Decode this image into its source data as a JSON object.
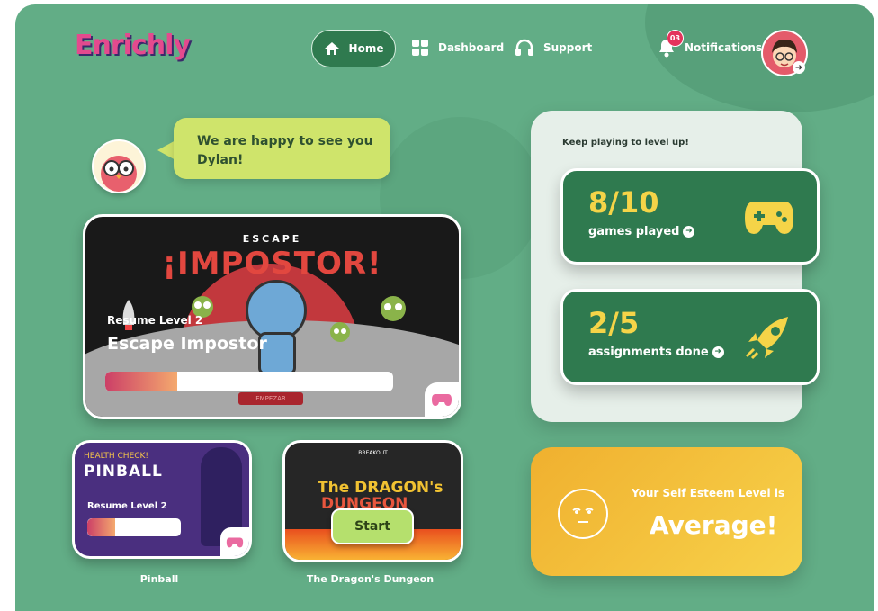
{
  "brand": {
    "logo": "Enrichly"
  },
  "nav": {
    "home": "Home",
    "dashboard": "Dashboard",
    "support": "Support",
    "notifications": "Notifications",
    "notification_count": "03"
  },
  "greeting": {
    "message": "We are happy to see you Dylan!"
  },
  "featured_game": {
    "art_title_small": "ESCAPE",
    "art_title_big": "¡IMPOSTOR!",
    "art_button": "EMPEZAR",
    "resume_label": "Resume Level 2",
    "name": "Escape Impostor",
    "progress": 0.25
  },
  "games": [
    {
      "caption": "Pinball",
      "art_label": "HEALTH CHECK!",
      "art_title": "PINBALL",
      "resume_label": "Resume Level 2",
      "progress": 0.3
    },
    {
      "caption": "The Dragon's Dungeon",
      "art_label": "BREAKOUT",
      "art_title_1": "The DRAGON's",
      "art_title_2": "DUNGEON",
      "start_label": "Start"
    }
  ],
  "progress_panel": {
    "title": "Keep playing to level up!",
    "games_played": {
      "value": "8/10",
      "label": "games played"
    },
    "assignments": {
      "value": "2/5",
      "label": "assignments done"
    }
  },
  "self_esteem": {
    "label": "Your Self Esteem Level is",
    "value": "Average!"
  },
  "colors": {
    "background": "#62ad86",
    "dark_green": "#2f7a4f",
    "accent_yellow": "#f5d448",
    "bubble": "#cfe46b",
    "esteem_card": "#f2bb32"
  }
}
